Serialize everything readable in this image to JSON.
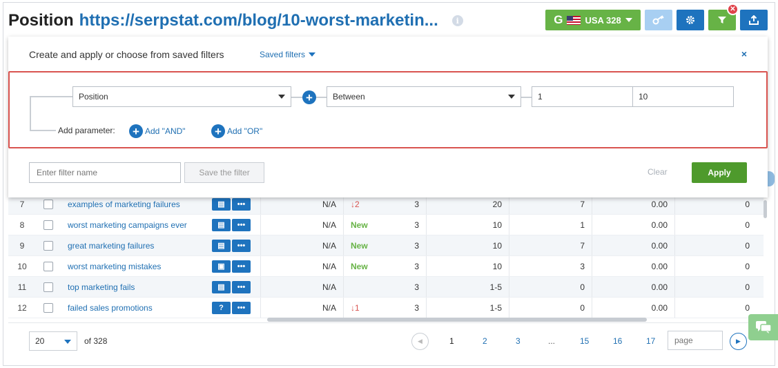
{
  "header": {
    "title_label": "Position",
    "title_url": "https://serpstat.com/blog/10-worst-marketin...",
    "info_icon": "info-icon"
  },
  "toolbar": {
    "region_label": "USA 328",
    "region_letter": "G",
    "key_icon": "key-icon",
    "gear_icon": "gear-icon",
    "filter_icon": "filter-icon",
    "export_icon": "export-icon",
    "accent": "#1e73be",
    "green": "#67b346"
  },
  "filter_modal": {
    "title": "Create and apply or choose from saved filters",
    "saved_filters_label": "Saved filters",
    "close_label": "×",
    "parameter_select": "Position",
    "condition_select": "Between",
    "value_from": "1",
    "value_to": "10",
    "add_parameter_label": "Add parameter:",
    "add_and_label": "Add \"AND\"",
    "add_or_label": "Add \"OR\"",
    "filter_name_placeholder": "Enter filter name",
    "save_filter_label": "Save the filter",
    "clear_label": "Clear",
    "apply_label": "Apply"
  },
  "table": {
    "rows": [
      {
        "num": "7",
        "keyword": "examples of marketing failures",
        "na": "N/A",
        "dyn": "↓2",
        "dyn_type": "down",
        "a": "3",
        "b": "20",
        "c": "7",
        "d": "0.00",
        "e": "0",
        "icon": "chat-icon"
      },
      {
        "num": "8",
        "keyword": "worst marketing campaigns ever",
        "na": "N/A",
        "dyn": "New",
        "dyn_type": "new",
        "a": "3",
        "b": "10",
        "c": "1",
        "d": "0.00",
        "e": "0",
        "icon": "chat-icon"
      },
      {
        "num": "9",
        "keyword": "great marketing failures",
        "na": "N/A",
        "dyn": "New",
        "dyn_type": "new",
        "a": "3",
        "b": "10",
        "c": "7",
        "d": "0.00",
        "e": "0",
        "icon": "chat-icon"
      },
      {
        "num": "10",
        "keyword": "worst marketing mistakes",
        "na": "N/A",
        "dyn": "New",
        "dyn_type": "new",
        "a": "3",
        "b": "10",
        "c": "3",
        "d": "0.00",
        "e": "0",
        "icon": "box-icon"
      },
      {
        "num": "11",
        "keyword": "top marketing fails",
        "na": "N/A",
        "dyn": "",
        "dyn_type": "none",
        "a": "3",
        "b": "1-5",
        "c": "0",
        "d": "0.00",
        "e": "0",
        "icon": "chat-icon"
      },
      {
        "num": "12",
        "keyword": "failed sales promotions",
        "na": "N/A",
        "dyn": "↓1",
        "dyn_type": "down",
        "a": "3",
        "b": "1-5",
        "c": "0",
        "d": "0.00",
        "e": "0",
        "icon": "question-icon"
      }
    ],
    "more_label": "•••"
  },
  "pagination": {
    "per_page": "20",
    "of_total": "of 328",
    "pages": [
      "1",
      "2",
      "3",
      "...",
      "15",
      "16",
      "17"
    ],
    "current_page": "1",
    "page_placeholder": "page"
  }
}
